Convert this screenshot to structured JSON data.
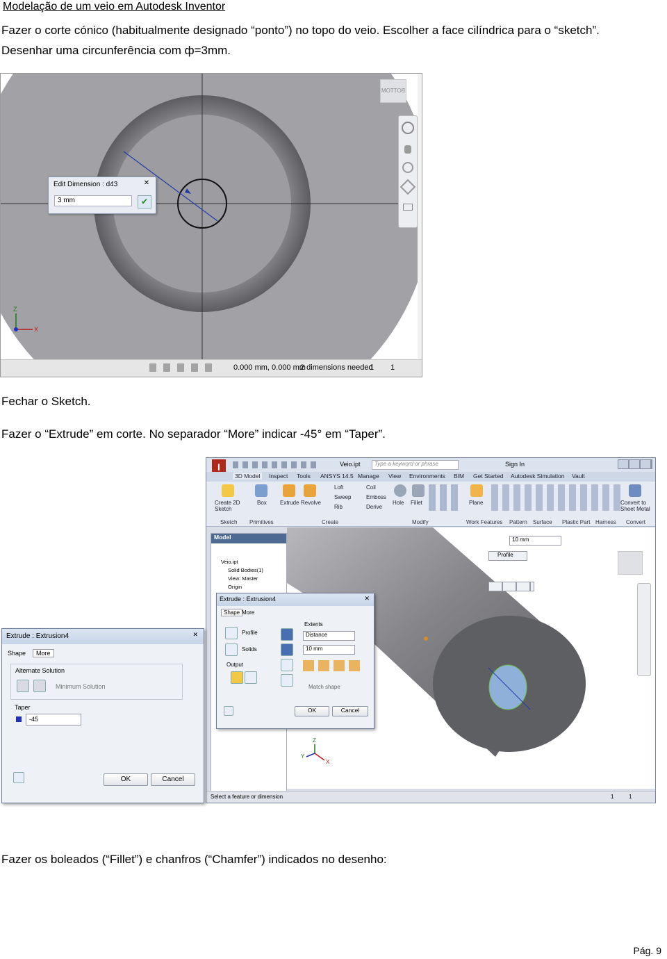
{
  "header": {
    "title": "Modelação de um veio em Autodesk Inventor"
  },
  "paragraphs": {
    "p1_line1": "Fazer o corte cónico (habitualmente designado “ponto”) no topo do veio. Escolher a face cilíndrica para o “sketch”.",
    "p1_line2": "Desenhar uma circunferência com ф=3mm.",
    "p2": "Fechar o Sketch.",
    "p3": "Fazer o “Extrude” em corte. No separador “More” indicar -45° em “Taper”.",
    "p4": "Fazer os boleados (“Fillet”) e chanfros (“Chamfer”) indicados no desenho:"
  },
  "screenshot1": {
    "viewcube_label": "BOTTOM",
    "edit_dimension": {
      "title": "Edit Dimension : d43",
      "value": "3 mm"
    },
    "axis_z": "Z",
    "axis_x": "X",
    "status": {
      "coords": "0.000 mm, 0.000 mm",
      "dims": "2 dimensions needed",
      "n1": "1",
      "n2": "1"
    }
  },
  "screenshot2": {
    "file": "Veio.ipt",
    "search_placeholder": "Type a keyword or phrase",
    "sign_in": "Sign In",
    "tabs": [
      "3D Model",
      "Inspect",
      "Tools",
      "ANSYS 14.5",
      "Manage",
      "View",
      "Environments",
      "BIM",
      "Get Started",
      "Autodesk Simulation",
      "Vault"
    ],
    "ribbon_labels": {
      "create_sketch": "Create 2D Sketch",
      "box": "Box",
      "extrude": "Extrude",
      "revolve": "Revolve",
      "loft": "Loft",
      "sweep": "Sweep",
      "rib": "Rib",
      "coil": "Coil",
      "emboss": "Emboss",
      "derive": "Derive",
      "hole": "Hole",
      "fillet": "Fillet",
      "plane": "Plane",
      "convert": "Convert to Sheet Metal"
    },
    "groups": [
      "Sketch",
      "Primitives",
      "Create",
      "Modify",
      "Work Features",
      "Pattern",
      "Surface",
      "Plastic Part",
      "Harness",
      "Convert"
    ],
    "browser": {
      "header": "Model",
      "items": [
        "Veio.ipt",
        "Solid Bodies(1)",
        "View: Master",
        "Origin"
      ]
    },
    "mini_toolbar": {
      "distance": "10 mm",
      "profile": "Profile"
    },
    "dialog": {
      "title": "Extrude : Extrusion4",
      "tab_shape": "Shape",
      "tab_more": "More",
      "profile": "Profile",
      "solids": "Solids",
      "output": "Output",
      "extents": "Extents",
      "extents_value": "Distance",
      "distance_value": "10 mm",
      "match_shape": "Match shape",
      "ok": "OK",
      "cancel": "Cancel"
    },
    "axis_z": "Z",
    "axis_y": "Y",
    "axis_x": "X",
    "status": {
      "text": "Select a feature or dimension",
      "n1": "1",
      "n2": "1"
    }
  },
  "screenshot3": {
    "title": "Extrude : Extrusion4",
    "tab_shape": "Shape",
    "tab_more": "More",
    "alternate_solution": "Alternate Solution",
    "minimum_solution": "Minimum Solution",
    "taper_label": "Taper",
    "taper_value": "-45",
    "ok": "OK",
    "cancel": "Cancel"
  },
  "footer": {
    "page": "Pág. 9"
  }
}
